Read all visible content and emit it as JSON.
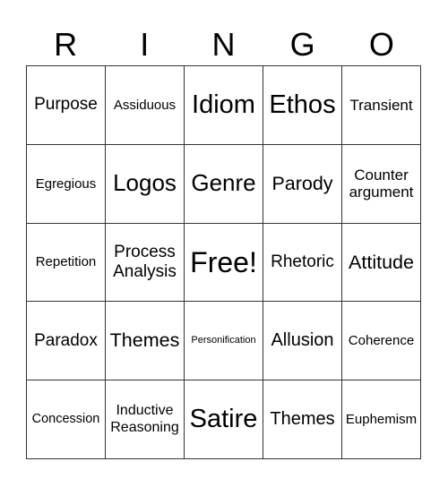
{
  "header": {
    "letters": [
      "R",
      "I",
      "N",
      "G",
      "O"
    ]
  },
  "board": {
    "rows": [
      [
        "Purpose",
        "Assiduous",
        "Idiom",
        "Ethos",
        "Transient"
      ],
      [
        "Egregious",
        "Logos",
        "Genre",
        "Parody",
        "Counter argument"
      ],
      [
        "Repetition",
        "Process Analysis",
        "Free!",
        "Rhetoric",
        "Attitude"
      ],
      [
        "Paradox",
        "Themes",
        "Personification",
        "Allusion",
        "Coherence"
      ],
      [
        "Concession",
        "Inductive Reasoning",
        "Satire",
        "Themes",
        "Euphemism"
      ]
    ]
  }
}
